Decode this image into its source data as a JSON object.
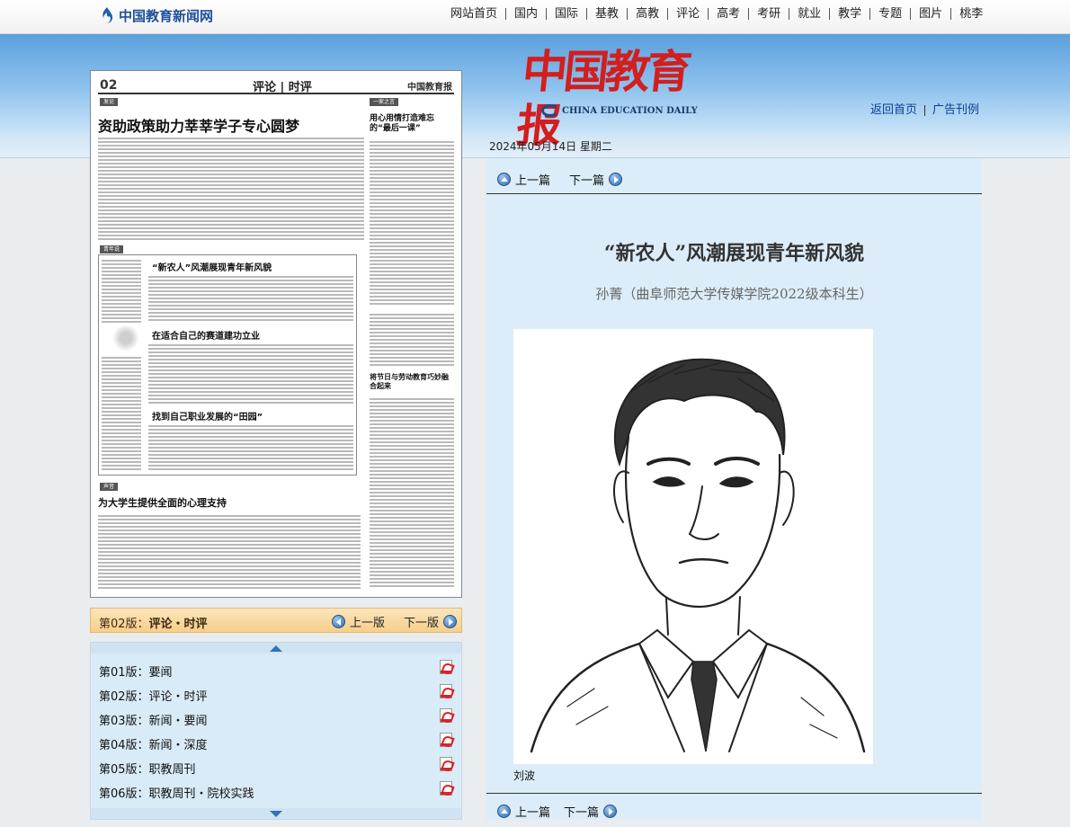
{
  "site": {
    "logo_text": "中国教育新闻网",
    "nav": [
      "网站首页",
      "国内",
      "国际",
      "基教",
      "高教",
      "评论",
      "高考",
      "考研",
      "就业",
      "教学",
      "专题",
      "图片",
      "桃李"
    ]
  },
  "masthead": {
    "name_cn": "中国教育报",
    "name_en": "CHINA EDUCATION DAILY",
    "links": [
      "返回首页",
      "广告刊例"
    ]
  },
  "date": "2024年05月14日 星期二",
  "page_preview": {
    "page_no": "02",
    "section": "评论 | 时评",
    "paper": "中国教育报",
    "headlines": [
      "资助政策助力莘莘学子专心圆梦",
      "“新农人”风潮展现青年新风貌",
      "在适合自己的赛道建功立业",
      "找到自己职业发展的“田园”",
      "为大学生提供全面的心理支持",
      "用心用情打造难忘的“最后一课”",
      "将节日与劳动教育巧妙融合起来"
    ],
    "tags": [
      "发论",
      "青年说",
      "声音",
      "一家之言"
    ]
  },
  "current_page": {
    "label": "第02版：",
    "value": "评论・时评",
    "prev": "上一版",
    "next": "下一版"
  },
  "editions": [
    "第01版：要闻",
    "第02版：评论・时评",
    "第03版：新闻・要闻",
    "第04版：新闻・深度",
    "第05版：职教周刊",
    "第06版：职教周刊・院校实践"
  ],
  "article": {
    "prev": "上一篇",
    "next": "下一篇",
    "title": "“新农人”风潮展现青年新风貌",
    "byline": "孙菁（曲阜师范大学传媒学院2022级本科生）",
    "caption": "刘波"
  }
}
